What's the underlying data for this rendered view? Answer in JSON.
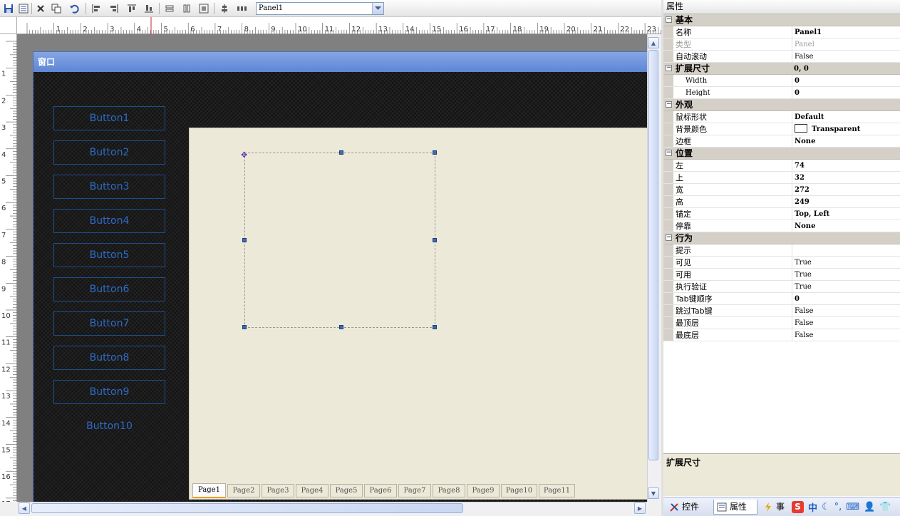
{
  "toolbar": {
    "selected_control": "Panel1",
    "buttons": [
      "save-icon",
      "properties-icon",
      "delete-icon",
      "copy-icon",
      "undo-icon",
      "align-left-icon",
      "align-right-icon",
      "align-top-icon",
      "align-bottom-icon",
      "same-width-icon",
      "same-height-icon",
      "same-size-icon",
      "center-vertical-icon",
      "spacing-icon"
    ]
  },
  "rulers": {
    "horizontal": [
      "1",
      "2",
      "3",
      "4",
      "5",
      "6",
      "7",
      "8",
      "9",
      "10",
      "11",
      "12",
      "13",
      "14",
      "15",
      "16",
      "17",
      "18",
      "19",
      "20",
      "21",
      "22",
      "23"
    ],
    "vertical": [
      "1",
      "2",
      "3",
      "4",
      "5",
      "6",
      "7",
      "8",
      "9",
      "10",
      "11",
      "12",
      "13",
      "14",
      "15",
      "16",
      "17"
    ]
  },
  "window": {
    "title": "窗口",
    "nav_buttons": [
      "Button1",
      "Button2",
      "Button3",
      "Button4",
      "Button5",
      "Button6",
      "Button7",
      "Button8",
      "Button9",
      "Button10"
    ],
    "tabs": [
      "Page1",
      "Page2",
      "Page3",
      "Page4",
      "Page5",
      "Page6",
      "Page7",
      "Page8",
      "Page9",
      "Page10",
      "Page11"
    ],
    "active_tab": "Page1"
  },
  "properties": {
    "title": "属性",
    "rows": [
      {
        "kind": "cat",
        "label": "基本"
      },
      {
        "kind": "prop",
        "name": "名称",
        "value": "Panel1",
        "bold": true
      },
      {
        "kind": "prop",
        "name": "类型",
        "value": "Panel",
        "dim": true
      },
      {
        "kind": "prop",
        "name": "自动滚动",
        "value": "False"
      },
      {
        "kind": "cat",
        "label": "扩展尺寸",
        "value": "0, 0"
      },
      {
        "kind": "prop",
        "name": "Width",
        "value": "0",
        "bold": true,
        "sub": true
      },
      {
        "kind": "prop",
        "name": "Height",
        "value": "0",
        "bold": true,
        "sub": true
      },
      {
        "kind": "cat",
        "label": "外观"
      },
      {
        "kind": "prop",
        "name": "鼠标形状",
        "value": "Default",
        "bold": true
      },
      {
        "kind": "prop",
        "name": "背景颜色",
        "value": "Transparent",
        "bold": true,
        "swatch": true
      },
      {
        "kind": "prop",
        "name": "边框",
        "value": "None",
        "bold": true
      },
      {
        "kind": "cat",
        "label": "位置"
      },
      {
        "kind": "prop",
        "name": "左",
        "value": "74",
        "bold": true
      },
      {
        "kind": "prop",
        "name": "上",
        "value": "32",
        "bold": true
      },
      {
        "kind": "prop",
        "name": "宽",
        "value": "272",
        "bold": true
      },
      {
        "kind": "prop",
        "name": "高",
        "value": "249",
        "bold": true
      },
      {
        "kind": "prop",
        "name": "锚定",
        "value": "Top, Left",
        "bold": true
      },
      {
        "kind": "prop",
        "name": "停靠",
        "value": "None",
        "bold": true
      },
      {
        "kind": "cat",
        "label": "行为"
      },
      {
        "kind": "prop",
        "name": "提示",
        "value": ""
      },
      {
        "kind": "prop",
        "name": "可见",
        "value": "True"
      },
      {
        "kind": "prop",
        "name": "可用",
        "value": "True"
      },
      {
        "kind": "prop",
        "name": "执行验证",
        "value": "True"
      },
      {
        "kind": "prop",
        "name": "Tab键顺序",
        "value": "0",
        "bold": true
      },
      {
        "kind": "prop",
        "name": "跳过Tab键",
        "value": "False"
      },
      {
        "kind": "prop",
        "name": "最顶层",
        "value": "False"
      },
      {
        "kind": "prop",
        "name": "最底层",
        "value": "False"
      }
    ],
    "description_title": "扩展尺寸"
  },
  "bottom_tabs": [
    {
      "label": "控件",
      "icon": "tools-icon"
    },
    {
      "label": "属性",
      "icon": "properties-icon",
      "active": true
    },
    {
      "label": "事件",
      "icon": "lightning-icon"
    }
  ],
  "ime": {
    "logo": "S",
    "mode": "中"
  },
  "colors": {
    "nav_text": "#2e6bc4",
    "title_bar": "#6a8fdc",
    "tab_page_bg": "#ece9d8"
  }
}
